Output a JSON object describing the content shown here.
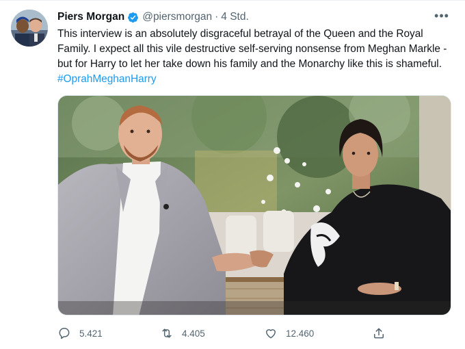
{
  "tweet": {
    "author_name": "Piers Morgan",
    "handle": "@piersmorgan",
    "separator": "·",
    "time": "4 Std.",
    "text_main": "This interview is an absolutely disgraceful betrayal of the Queen and the Royal Family. I expect all this vile destructive self-serving nonsense from Meghan Markle - but for Harry to let her take down his family and the Monarchy like this is shameful.",
    "hashtag": "#OprahMeghanHarry",
    "more_icon": "•••",
    "replies": "5.421",
    "retweets": "4.405",
    "likes": "12.460"
  },
  "colors": {
    "accent": "#1d9bf0",
    "text": "#0f1419",
    "secondary": "#536471"
  },
  "icons": {
    "verified": "verified-badge-icon",
    "more": "more-options-icon",
    "reply": "reply-icon",
    "retweet": "retweet-icon",
    "like": "like-icon",
    "share": "share-icon"
  }
}
